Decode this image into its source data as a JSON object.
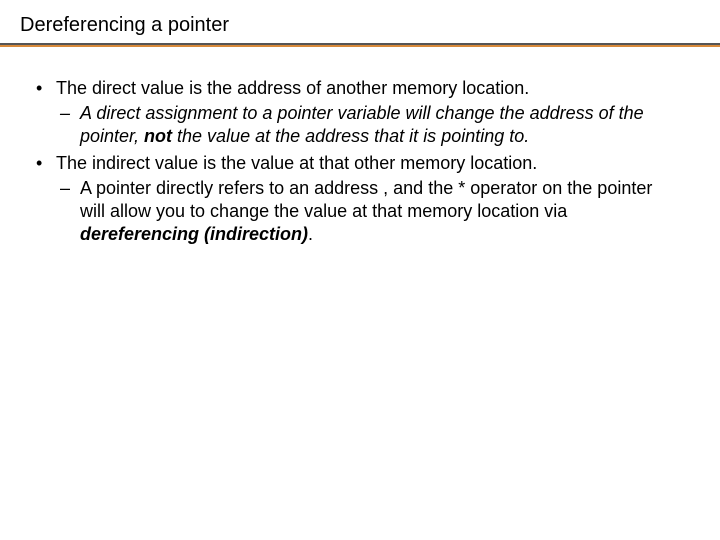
{
  "title": "Dereferencing a pointer",
  "bullets": {
    "b1": "The direct value is the address of another memory location.",
    "b1_sub_a": "A direct assignment to a pointer variable will change the address of the pointer, ",
    "b1_sub_b": "not",
    "b1_sub_c": " the value at the address that it is pointing to.",
    "b2": "The indirect value is the value at that other memory location.",
    "b2_sub_a": "A pointer directly refers to an address , and the * operator on the pointer will allow you to change the value at that memory location via ",
    "b2_sub_b": "dereferencing (indirection)",
    "b2_sub_c": "."
  }
}
